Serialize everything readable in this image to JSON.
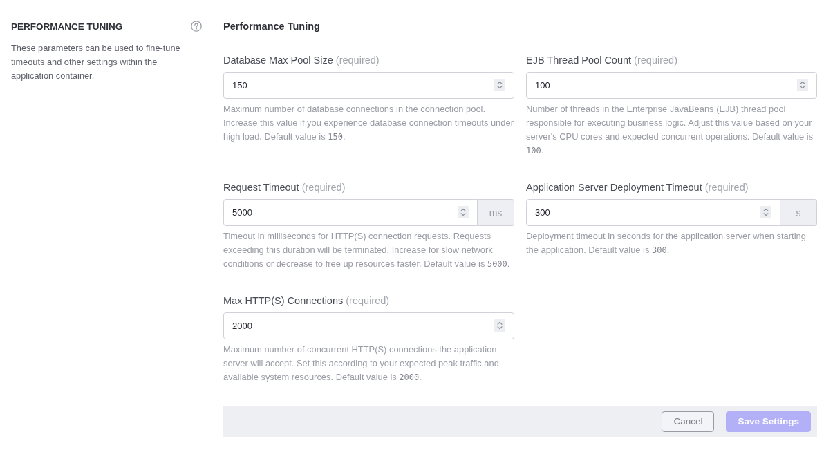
{
  "sidebar": {
    "title": "PERFORMANCE TUNING",
    "description": "These parameters can be used to fine-tune timeouts and other settings within the application container."
  },
  "section": {
    "title": "Performance Tuning"
  },
  "fields": [
    {
      "label": "Database Max Pool Size",
      "required_note": "(required)",
      "value": "150",
      "help": "Maximum number of database connections in the connection pool. Increase this value if you experience database connection timeouts under high load. Default value is",
      "default_value": "150",
      "help_end": "."
    },
    {
      "label": "EJB Thread Pool Count",
      "required_note": "(required)",
      "value": "100",
      "help": "Number of threads in the Enterprise JavaBeans (EJB) thread pool responsible for executing business logic. Adjust this value based on your server's CPU cores and expected concurrent operations. Default value is",
      "default_value": "100",
      "help_end": "."
    },
    {
      "label": "Request Timeout",
      "required_note": "(required)",
      "value": "5000",
      "unit": "ms",
      "help": "Timeout in milliseconds for HTTP(S) connection requests. Requests exceeding this duration will be terminated. Increase for slow network conditions or decrease to free up resources faster. Default value is",
      "default_value": "5000",
      "help_end": "."
    },
    {
      "label": "Application Server Deployment Timeout",
      "required_note": "(required)",
      "value": "300",
      "unit": "s",
      "help": "Deployment timeout in seconds for the application server when starting the application. Default value is",
      "default_value": "300",
      "help_end": "."
    },
    {
      "label": "Max HTTP(S) Connections",
      "required_note": "(required)",
      "value": "2000",
      "help": "Maximum number of concurrent HTTP(S) connections the application server will accept. Set this according to your expected peak traffic and available system resources. Default value is",
      "default_value": "2000",
      "help_end": "."
    }
  ],
  "footer": {
    "buttons": [
      {
        "label": "Cancel",
        "kind": "secondary",
        "disabled": false
      },
      {
        "label": "Save Settings",
        "kind": "primary",
        "disabled": true
      }
    ]
  }
}
